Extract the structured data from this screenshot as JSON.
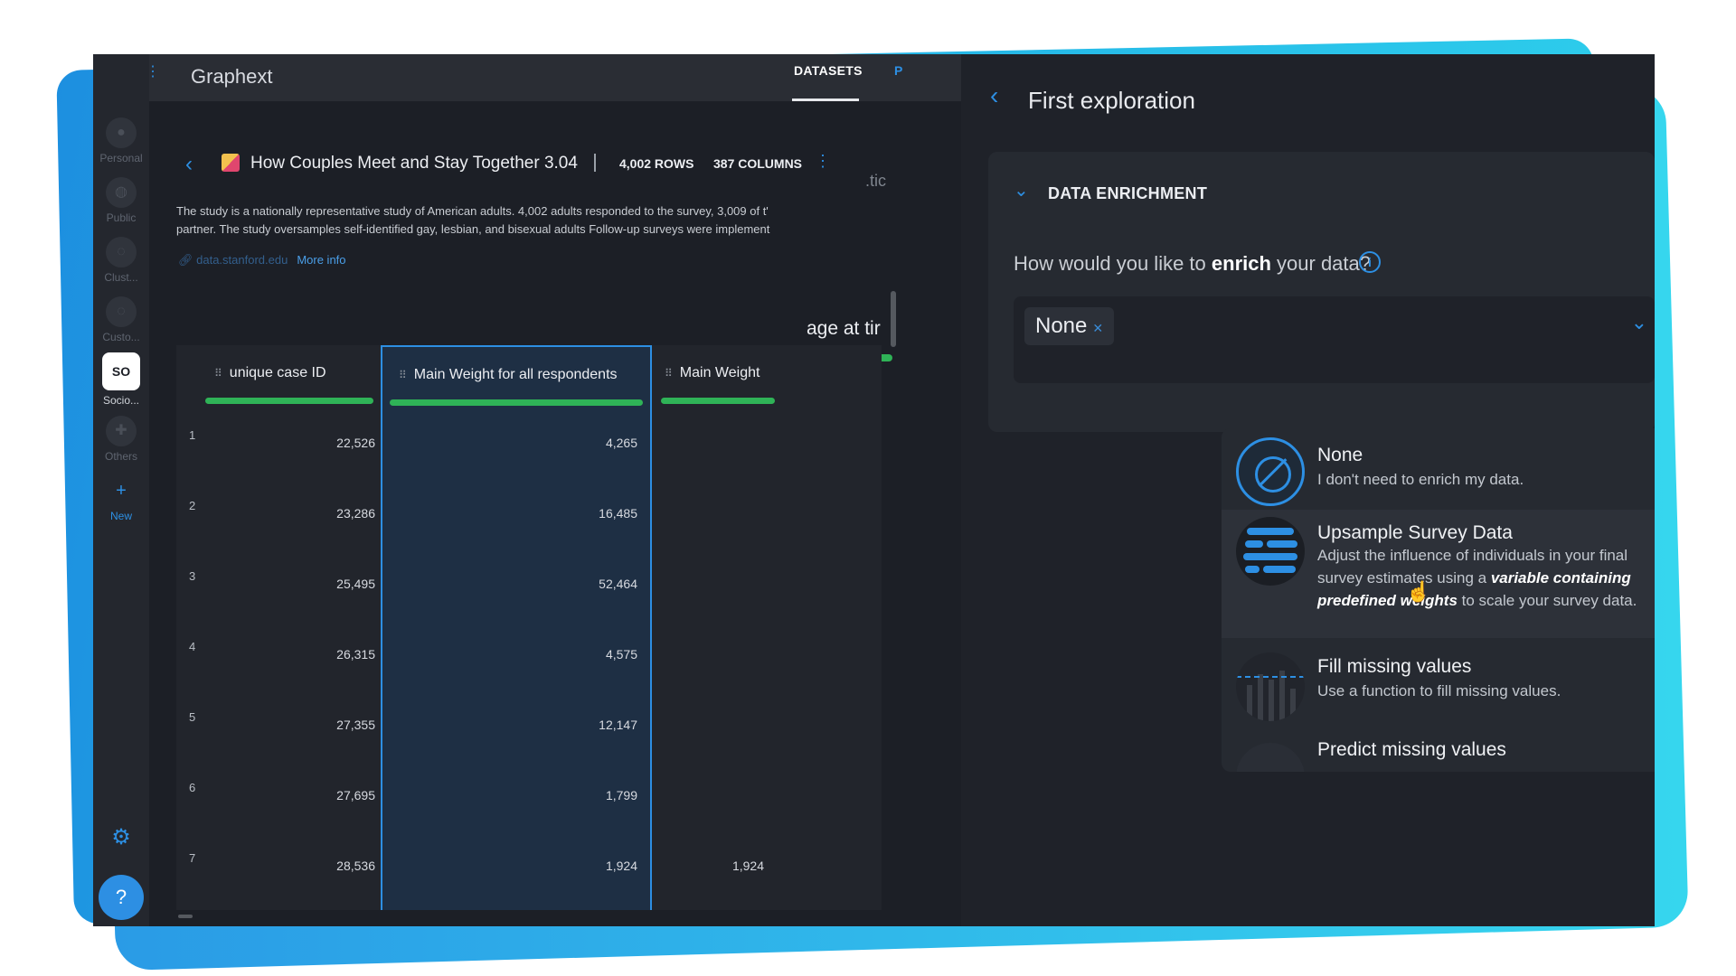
{
  "app": {
    "title": "Graphext"
  },
  "topbar": {
    "tab_datasets": "DATASETS",
    "tab_more": "P"
  },
  "rail": {
    "items": [
      {
        "label": "Personal",
        "icon": "person-icon"
      },
      {
        "label": "Public",
        "icon": "globe-icon"
      },
      {
        "label": "Clust...",
        "icon": "cluster-icon"
      },
      {
        "label": "Custo...",
        "icon": "custom-icon"
      },
      {
        "label": "Socio...",
        "icon_text": "SO"
      },
      {
        "label": "Others",
        "icon": "others-icon"
      },
      {
        "label": "New",
        "icon_text": "+"
      }
    ],
    "help": "?"
  },
  "dataset": {
    "title": "How Couples Meet and Stay Together 3.04",
    "rows": "4,002 ROWS",
    "columns": "387 COLUMNS",
    "description_1": "The study is a nationally representative study of American adults. 4,002 adults responded to the survey, 3,009 of t'",
    "description_2": "partner. The study oversamples self-identified gay, lesbian, and bisexual adults Follow-up surveys were implement",
    "link": "data.stanford.edu",
    "more_info": "More info",
    "partial_tab": ".tic",
    "partial_col": "age at tir"
  },
  "table": {
    "columns": [
      "unique case ID",
      "Main Weight for all respondents",
      "Main Weight"
    ],
    "rows": [
      {
        "n": "1",
        "a": "22,526",
        "b": "4,265",
        "c": ""
      },
      {
        "n": "2",
        "a": "23,286",
        "b": "16,485",
        "c": ""
      },
      {
        "n": "3",
        "a": "25,495",
        "b": "52,464",
        "c": ""
      },
      {
        "n": "4",
        "a": "26,315",
        "b": "4,575",
        "c": ""
      },
      {
        "n": "5",
        "a": "27,355",
        "b": "12,147",
        "c": ""
      },
      {
        "n": "6",
        "a": "27,695",
        "b": "1,799",
        "c": ""
      },
      {
        "n": "7",
        "a": "28,536",
        "b": "1,924",
        "c": "1,924"
      }
    ]
  },
  "exploration": {
    "title": "First exploration",
    "section": "DATA ENRICHMENT",
    "question_pre": "How would you like to ",
    "question_bold": "enrich",
    "question_post": " your data?",
    "selected": "None",
    "options": [
      {
        "title": "None",
        "desc": "I don't need to enrich my data."
      },
      {
        "title": "Upsample Survey Data",
        "desc_pre": "Adjust the influence of individuals in your final survey estimates using a ",
        "desc_em": "variable containing predefined weights",
        "desc_post": " to scale your survey data."
      },
      {
        "title": "Fill missing values",
        "desc": "Use a function to fill missing values."
      },
      {
        "title": "Predict missing values",
        "desc": ""
      }
    ]
  },
  "colors": {
    "accent": "#2d8fe3",
    "bar": "#2fb357",
    "background": "#1c1f26"
  }
}
